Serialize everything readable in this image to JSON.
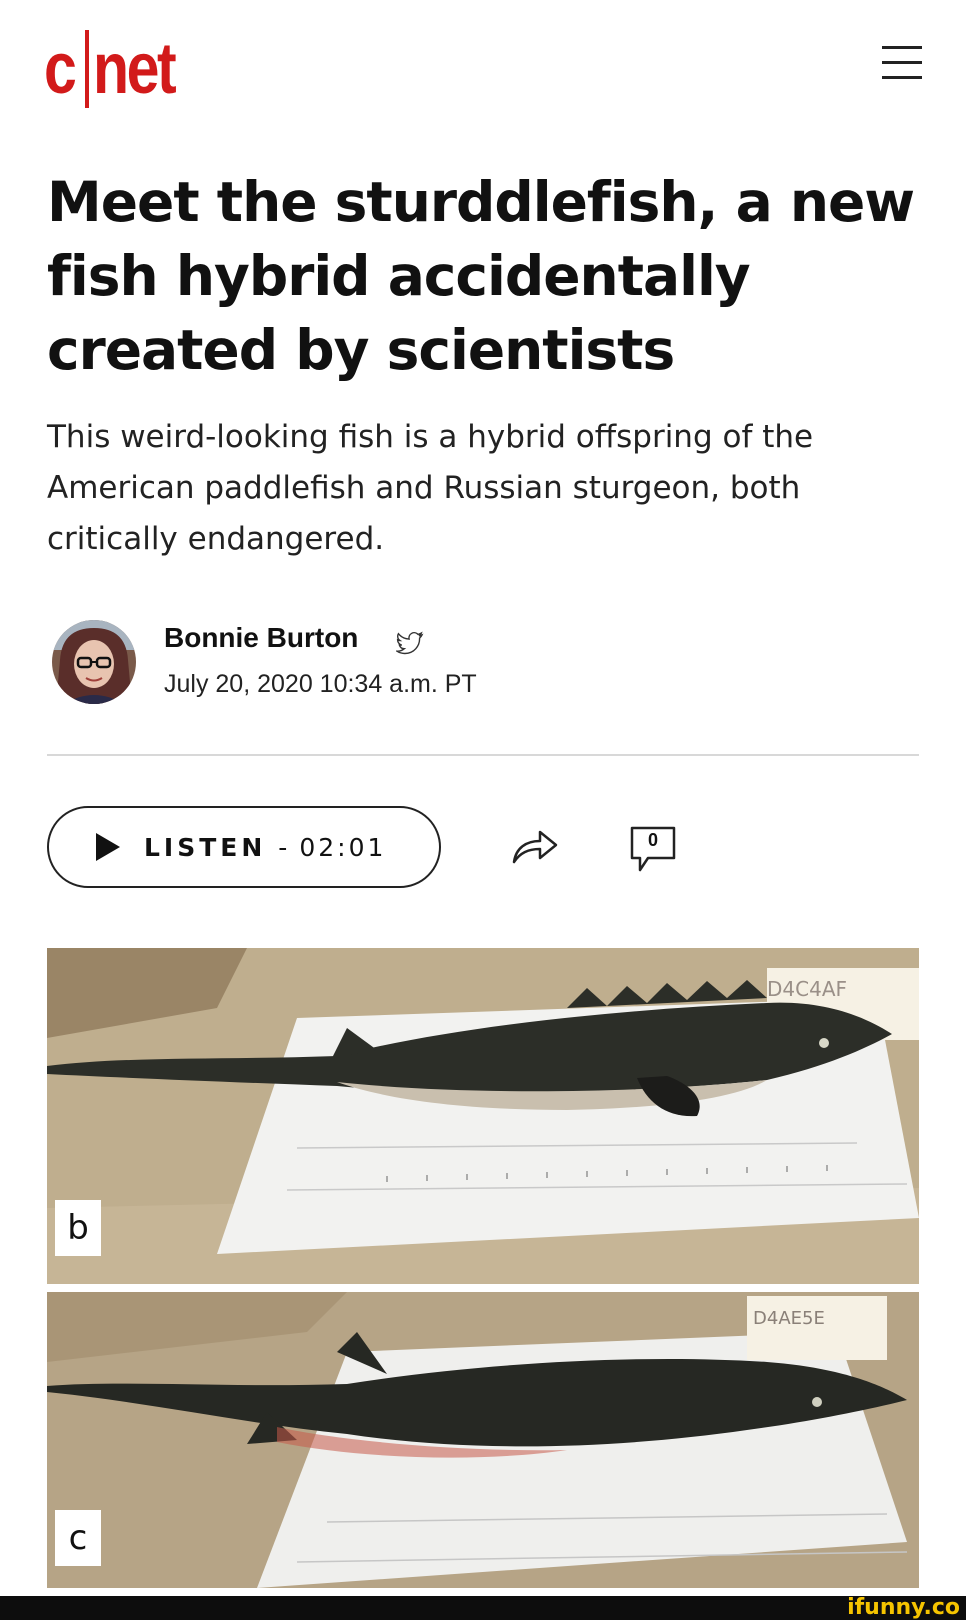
{
  "header": {
    "logo_text": "cnet",
    "logo_left": "c",
    "logo_right": "net"
  },
  "article": {
    "headline": "Meet the sturddlefish, a new fish hybrid accidentally created by scientists",
    "dek": "This weird-looking fish is a hybrid offspring of the American paddlefish and Russian sturgeon, both critically endangered.",
    "author": "Bonnie Burton",
    "date": "July 20, 2020 10:34 a.m. PT"
  },
  "actions": {
    "listen_label": "LISTEN",
    "listen_separator": "-",
    "listen_duration": "02:01",
    "comment_count": "0"
  },
  "photos": {
    "panel_b": {
      "label": "b",
      "tag": "D4C4AF"
    },
    "panel_c": {
      "label": "c",
      "tag": "D4AE5E"
    }
  },
  "footer": {
    "watermark": "ifunny.co"
  },
  "colors": {
    "brand": "#d21a1a",
    "watermark": "#f5c400"
  }
}
